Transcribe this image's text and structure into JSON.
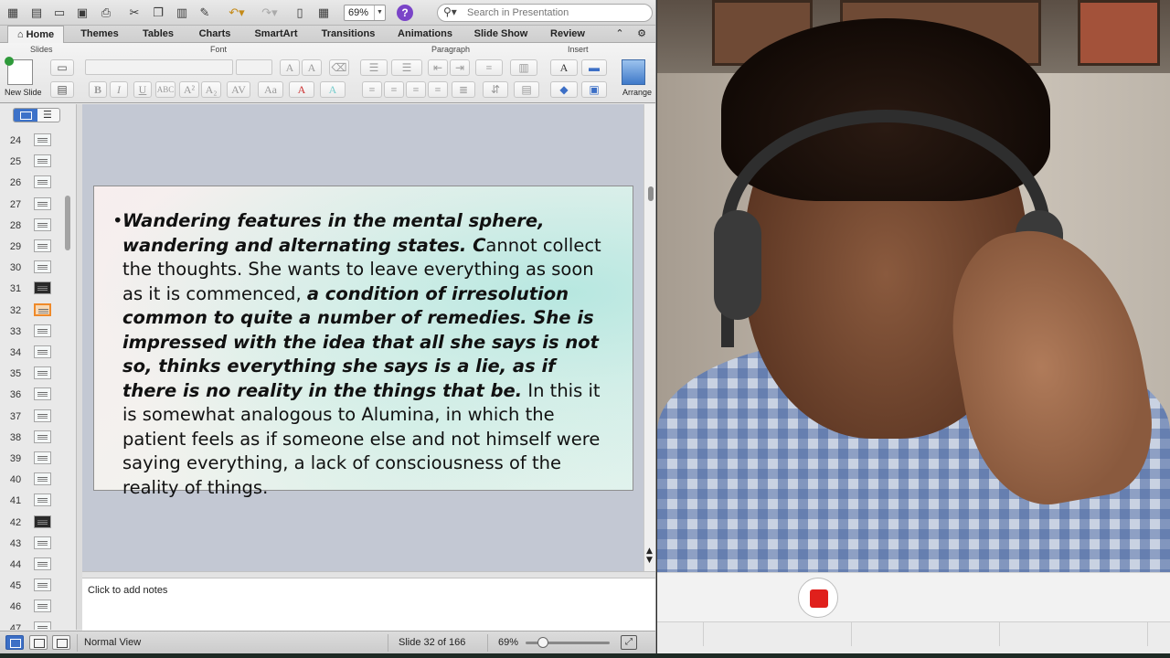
{
  "toolbar": {
    "zoom": "69%",
    "search_placeholder": "Search in Presentation"
  },
  "ribbon": {
    "tabs": [
      "Home",
      "Themes",
      "Tables",
      "Charts",
      "SmartArt",
      "Transitions",
      "Animations",
      "Slide Show",
      "Review"
    ],
    "active_tab": "Home",
    "groups": {
      "slides": "Slides",
      "font": "Font",
      "paragraph": "Paragraph",
      "insert": "Insert"
    },
    "new_slide_label": "New Slide",
    "arrange_label": "Arrange"
  },
  "slide_pane": {
    "thumbnails": [
      {
        "num": "24"
      },
      {
        "num": "25"
      },
      {
        "num": "26"
      },
      {
        "num": "27"
      },
      {
        "num": "28"
      },
      {
        "num": "29"
      },
      {
        "num": "30"
      },
      {
        "num": "31"
      },
      {
        "num": "32"
      },
      {
        "num": "33"
      },
      {
        "num": "34"
      },
      {
        "num": "35"
      },
      {
        "num": "36"
      },
      {
        "num": "37"
      },
      {
        "num": "38"
      },
      {
        "num": "39"
      },
      {
        "num": "40"
      },
      {
        "num": "41"
      },
      {
        "num": "42"
      },
      {
        "num": "43"
      },
      {
        "num": "44"
      },
      {
        "num": "45"
      },
      {
        "num": "46"
      },
      {
        "num": "47"
      }
    ],
    "current": "32"
  },
  "slide": {
    "runs": [
      {
        "text": "Wandering features in the mental sphere, wandering and alternating states. C",
        "emph": true
      },
      {
        "text": "annot collect the thoughts. She wants to leave everything as soon as it is commenced, ",
        "emph": false
      },
      {
        "text": "a condition of irresolution common to quite a number of remedies. She is impressed with the idea that all she says is not so, thinks everything she says is a lie, as if there is no reality in the things that be.",
        "emph": true
      },
      {
        "text": " In this it is somewhat analogous to Alumina, in which the patient feels as if someone else and not himself were saying everything, a lack of consciousness of the reality of things.",
        "emph": false
      }
    ]
  },
  "notes_placeholder": "Click to add notes",
  "status": {
    "view": "Normal View",
    "slide_position": "Slide 32 of 166",
    "zoom": "69%"
  },
  "colors": {
    "accent": "#3c6fc6",
    "current_thumb": "#ef8a2a",
    "record": "#e0201c"
  }
}
